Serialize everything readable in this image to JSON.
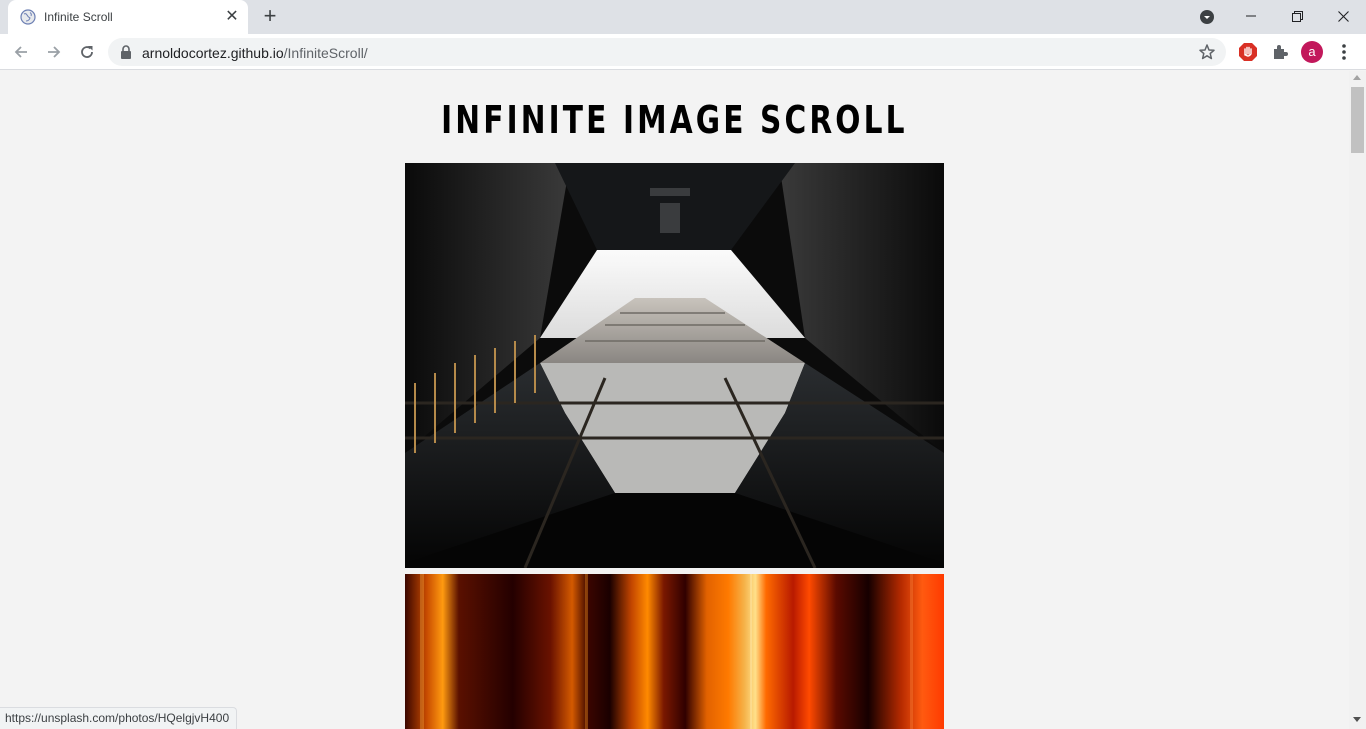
{
  "browser": {
    "tab": {
      "title": "Infinite Scroll",
      "favicon": "globe-icon"
    },
    "url": {
      "host": "arnoldocortez.github.io",
      "path": "/InfiniteScroll/"
    },
    "profile_initial": "a",
    "accent_profile_color": "#c2185b"
  },
  "page": {
    "title": "INFINITE IMAGE SCROLL",
    "images": [
      {
        "name": "architecture-photo",
        "subject": "looking up between two dark buildings toward a tall tower and sky"
      },
      {
        "name": "abstract-fire-photo",
        "subject": "vertical streaks of orange, red and yellow light"
      }
    ]
  },
  "status_bar": {
    "link_url": "https://unsplash.com/photos/HQelgjvH400"
  }
}
